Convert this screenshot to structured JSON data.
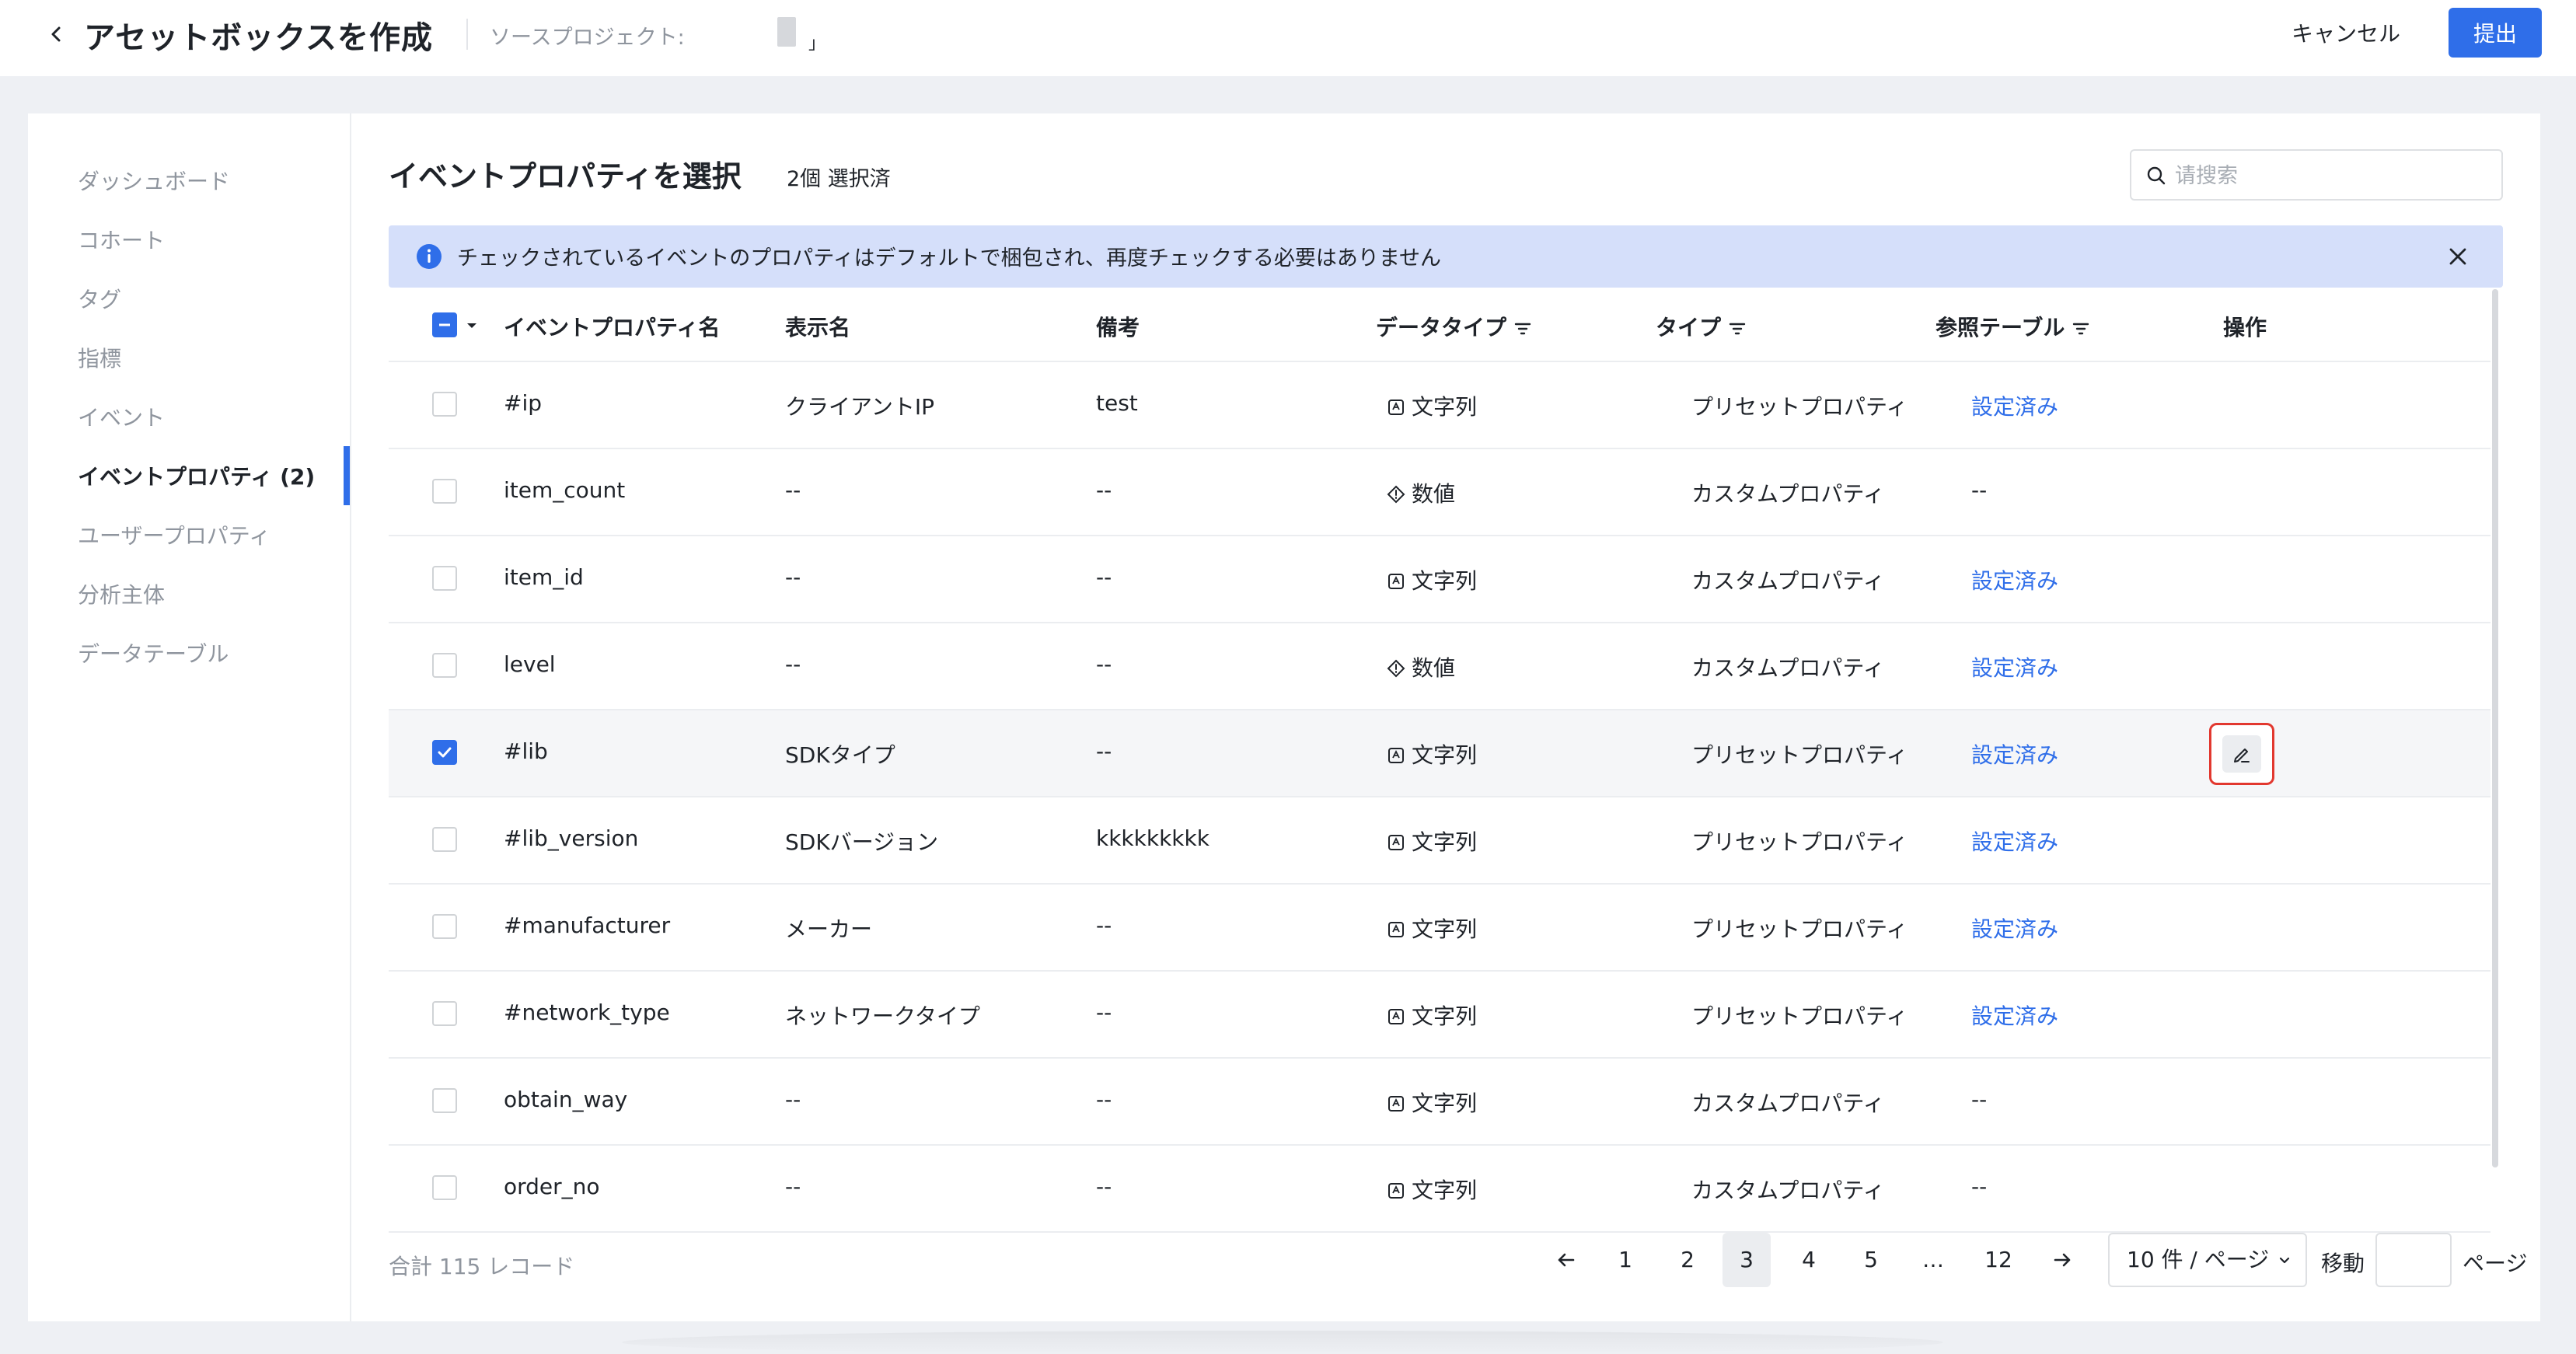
{
  "header": {
    "title": "アセットボックスを作成",
    "source_label": "ソースプロジェクト:",
    "source_value": "」",
    "cancel_label": "キャンセル",
    "submit_label": "提出"
  },
  "sidebar": {
    "items": [
      {
        "label": "ダッシュボード"
      },
      {
        "label": "コホート"
      },
      {
        "label": "タグ"
      },
      {
        "label": "指標"
      },
      {
        "label": "イベント"
      },
      {
        "label": "イベントプロパティ (2)",
        "active": true
      },
      {
        "label": "ユーザープロパティ"
      },
      {
        "label": "分析主体"
      },
      {
        "label": "データテーブル"
      }
    ]
  },
  "main": {
    "title": "イベントプロパティを選択",
    "selected_count": "2個 選択済",
    "search_placeholder": "请搜索",
    "banner_text": "チェックされているイベントのプロパティはデフォルトで梱包され、再度チェックする必要はありません",
    "columns": [
      "イベントプロパティ名",
      "表示名",
      "備考",
      "データタイプ",
      "タイプ",
      "参照テーブル",
      "操作"
    ],
    "rows": [
      {
        "name": "#ip",
        "display": "クライアントIP",
        "note": "test",
        "dtype": "文字列",
        "dtype_icon": "string-icon",
        "type": "プリセットプロパティ",
        "ref": "設定済み",
        "checked": false
      },
      {
        "name": "item_count",
        "display": "--",
        "note": "--",
        "dtype": "数値",
        "dtype_icon": "number-icon",
        "type": "カスタムプロパティ",
        "ref": "--",
        "checked": false
      },
      {
        "name": "item_id",
        "display": "--",
        "note": "--",
        "dtype": "文字列",
        "dtype_icon": "string-icon",
        "type": "カスタムプロパティ",
        "ref": "設定済み",
        "checked": false
      },
      {
        "name": "level",
        "display": "--",
        "note": "--",
        "dtype": "数値",
        "dtype_icon": "number-icon",
        "type": "カスタムプロパティ",
        "ref": "設定済み",
        "checked": false
      },
      {
        "name": "#lib",
        "display": "SDKタイプ",
        "note": "--",
        "dtype": "文字列",
        "dtype_icon": "string-icon",
        "type": "プリセットプロパティ",
        "ref": "設定済み",
        "checked": true,
        "highlighted": true,
        "edit": true
      },
      {
        "name": "#lib_version",
        "display": "SDKバージョン",
        "note": "kkkkkkkkk",
        "dtype": "文字列",
        "dtype_icon": "string-icon",
        "type": "プリセットプロパティ",
        "ref": "設定済み",
        "checked": false
      },
      {
        "name": "#manufacturer",
        "display": "メーカー",
        "note": "--",
        "dtype": "文字列",
        "dtype_icon": "string-icon",
        "type": "プリセットプロパティ",
        "ref": "設定済み",
        "checked": false
      },
      {
        "name": "#network_type",
        "display": "ネットワークタイプ",
        "note": "--",
        "dtype": "文字列",
        "dtype_icon": "string-icon",
        "type": "プリセットプロパティ",
        "ref": "設定済み",
        "checked": false
      },
      {
        "name": "obtain_way",
        "display": "--",
        "note": "--",
        "dtype": "文字列",
        "dtype_icon": "string-icon",
        "type": "カスタムプロパティ",
        "ref": "--",
        "checked": false
      },
      {
        "name": "order_no",
        "display": "--",
        "note": "--",
        "dtype": "文字列",
        "dtype_icon": "string-icon",
        "type": "カスタムプロパティ",
        "ref": "--",
        "checked": false
      }
    ]
  },
  "footer": {
    "total": "合計 115 レコード",
    "pages": [
      "1",
      "2",
      "3",
      "4",
      "5",
      "…",
      "12"
    ],
    "current_page": "3",
    "page_size": "10 件 / ページ",
    "jump_label": "移動",
    "page_unit": "ページ"
  },
  "colors": {
    "accent": "#2f6ee9",
    "banner_bg": "#d5dffa",
    "highlight_border": "#e2382f"
  }
}
